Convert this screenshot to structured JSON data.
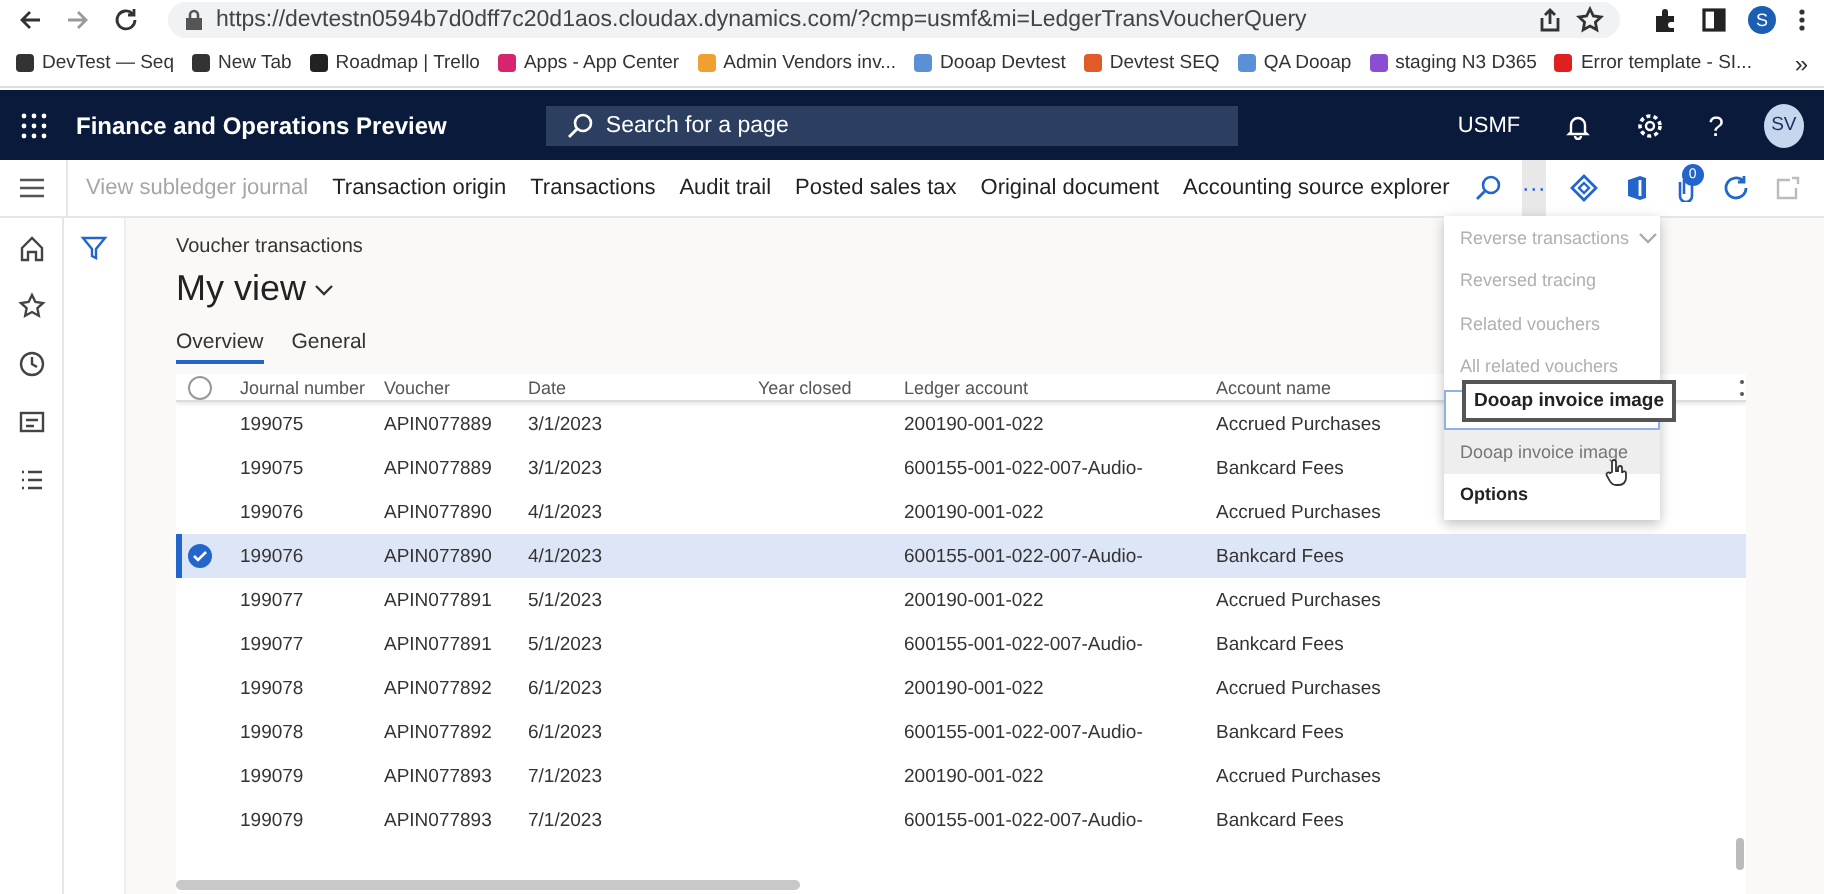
{
  "browser": {
    "url": "https://devtestn0594b7d0dff7c20d1aos.cloudax.dynamics.com/?cmp=usmf&mi=LedgerTransVoucherQuery",
    "profile": "S",
    "bookmarks": [
      {
        "label": "DevTest — Seq",
        "color": "#333333"
      },
      {
        "label": "New Tab",
        "color": "#333333"
      },
      {
        "label": "Roadmap | Trello",
        "color": "#222222"
      },
      {
        "label": "Apps - App Center",
        "color": "#d6246e"
      },
      {
        "label": "Admin Vendors inv...",
        "color": "#f0a030"
      },
      {
        "label": "Dooap Devtest",
        "color": "#5b8fd6"
      },
      {
        "label": "Devtest SEQ",
        "color": "#e05a2a"
      },
      {
        "label": "QA Dooap",
        "color": "#5b8fd6"
      },
      {
        "label": "staging N3 D365",
        "color": "#8a4fd0"
      },
      {
        "label": "Error template - SI...",
        "color": "#e02020"
      }
    ],
    "more": "»"
  },
  "app": {
    "title": "Finance and Operations Preview",
    "search_placeholder": "Search for a page",
    "company": "USMF",
    "help": "?",
    "user": "SV"
  },
  "action_bar": {
    "items": [
      {
        "label": "View subledger journal",
        "disabled": true
      },
      {
        "label": "Transaction origin",
        "disabled": false
      },
      {
        "label": "Transactions",
        "disabled": false
      },
      {
        "label": "Audit trail",
        "disabled": false
      },
      {
        "label": "Posted sales tax",
        "disabled": false
      },
      {
        "label": "Original document",
        "disabled": false
      },
      {
        "label": "Accounting source explorer",
        "disabled": false
      }
    ],
    "more": "···",
    "more_open": true,
    "attachments_badge": "0"
  },
  "page": {
    "caption": "Voucher transactions",
    "view": "My view",
    "tabs": [
      {
        "label": "Overview",
        "selected": true
      },
      {
        "label": "General",
        "selected": false
      }
    ]
  },
  "grid": {
    "all_selected": false,
    "columns": [
      "Journal number",
      "Voucher",
      "Date",
      "Year closed",
      "Ledger account",
      "Account name"
    ],
    "rows": [
      {
        "cells": [
          "199075",
          "APIN077889",
          "3/1/2023",
          "",
          "200190-001-022",
          "Accrued Purchases"
        ],
        "selected": false
      },
      {
        "cells": [
          "199075",
          "APIN077889",
          "3/1/2023",
          "",
          "600155-001-022-007-Audio-",
          "Bankcard Fees"
        ],
        "selected": false
      },
      {
        "cells": [
          "199076",
          "APIN077890",
          "4/1/2023",
          "",
          "200190-001-022",
          "Accrued Purchases"
        ],
        "selected": false
      },
      {
        "cells": [
          "199076",
          "APIN077890",
          "4/1/2023",
          "",
          "600155-001-022-007-Audio-",
          "Bankcard Fees"
        ],
        "selected": true
      },
      {
        "cells": [
          "199077",
          "APIN077891",
          "5/1/2023",
          "",
          "200190-001-022",
          "Accrued Purchases"
        ],
        "selected": false
      },
      {
        "cells": [
          "199077",
          "APIN077891",
          "5/1/2023",
          "",
          "600155-001-022-007-Audio-",
          "Bankcard Fees"
        ],
        "selected": false
      },
      {
        "cells": [
          "199078",
          "APIN077892",
          "6/1/2023",
          "",
          "200190-001-022",
          "Accrued Purchases"
        ],
        "selected": false
      },
      {
        "cells": [
          "199078",
          "APIN077892",
          "6/1/2023",
          "",
          "600155-001-022-007-Audio-",
          "Bankcard Fees"
        ],
        "selected": false
      },
      {
        "cells": [
          "199079",
          "APIN077893",
          "7/1/2023",
          "",
          "200190-001-022",
          "Accrued Purchases"
        ],
        "selected": false
      },
      {
        "cells": [
          "199079",
          "APIN077893",
          "7/1/2023",
          "",
          "600155-001-022-007-Audio-",
          "Bankcard Fees"
        ],
        "selected": false
      }
    ]
  },
  "menu": {
    "items": [
      {
        "label": "Reverse transactions",
        "disabled": true,
        "hovered": false,
        "submenu": true
      },
      {
        "label": "Reversed tracing",
        "disabled": true,
        "hovered": false,
        "submenu": false
      },
      {
        "label": "Related vouchers",
        "disabled": true,
        "hovered": false,
        "submenu": false
      },
      {
        "label": "All related vouchers",
        "disabled": true,
        "hovered": false,
        "submenu": false
      },
      {
        "label": "Dooap invoice image",
        "disabled": false,
        "hovered": true,
        "submenu": false
      },
      {
        "label": "Options",
        "disabled": false,
        "hovered": false,
        "submenu": false
      }
    ],
    "tooltip": "Dooap invoice image"
  }
}
